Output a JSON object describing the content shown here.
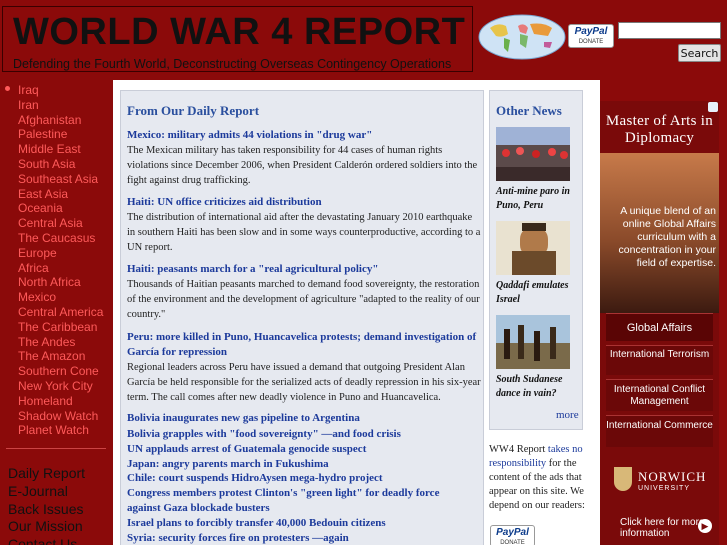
{
  "header": {
    "title": "WORLD WAR 4 REPORT",
    "tagline": "Defending the Fourth World, Deconstructing Overseas Contingency Operations",
    "paypal_label": "PayPal",
    "paypal_sub": "DONATE",
    "search_value": "",
    "search_button": "Search"
  },
  "sidebar": {
    "regions": [
      "Iraq",
      "Iran",
      "Afghanistan",
      "Palestine",
      "Middle East",
      "South Asia",
      "Southeast Asia",
      "East Asia",
      "Oceania",
      "Central Asia",
      "The Caucasus",
      "Europe",
      "Africa",
      "North Africa",
      "Mexico",
      "Central America",
      "The Caribbean",
      "The Andes",
      "The Amazon",
      "Southern Cone",
      "New York City",
      "Homeland",
      "Shadow Watch",
      "Planet Watch"
    ],
    "links": [
      "Daily Report",
      "E-Journal",
      "Back Issues",
      "Our Mission",
      "Contact Us"
    ]
  },
  "daily": {
    "heading": "From Our Daily Report",
    "stories": [
      {
        "title": "Mexico: military admits 44 violations in \"drug war\"",
        "body": "The Mexican military has taken responsibility for 44 cases of human rights violations since December 2006, when President Calderón ordered soldiers into the fight against drug trafficking."
      },
      {
        "title": "Haiti: UN office criticizes aid distribution",
        "body": "The distribution of international aid after the devastating January 2010 earthquake in southern Haiti has been slow and in some ways counterproductive, according to a UN report."
      },
      {
        "title": "Haiti: peasants march for a \"real agricultural policy\"",
        "body": "Thousands of Haitian peasants marched to demand food sovereignty, the restoration of the environment and the development of agriculture \"adapted to the reality of our country.\""
      },
      {
        "title": "Peru: more killed in Puno, Huancavelica protests; demand investigation of García for repression",
        "body": "Regional leaders across Peru have issued a demand that outgoing President Alan García be held responsible for the serialized acts of deadly repression in his six-year term. The call comes after new deadly violence in Puno and Huancavelica."
      }
    ],
    "headlines": [
      "Bolivia inaugurates new gas pipeline to Argentina",
      "Bolivia grapples with \"food sovereignty\" —and food crisis",
      "UN applauds arrest of Guatemala genocide suspect",
      "Japan: angry parents march in Fukushima",
      "Chile: court suspends HidroAysen mega-hydro project",
      "Congress members protest Clinton's \"green light\" for deadly force against Gaza blockade busters",
      "Israel plans to forcibly transfer 40,000 Bedouin citizens",
      "Syria: security forces fire on protesters —again"
    ]
  },
  "other": {
    "heading": "Other News",
    "items": [
      {
        "caption": "Anti-mine paro in Puno, Peru"
      },
      {
        "caption": "Qaddafi emulates Israel"
      },
      {
        "caption": "South Sudanese dance in vain?"
      }
    ],
    "more": "more"
  },
  "disclaimer": {
    "pre": "WW4 Report ",
    "link": "takes no responsibility",
    "post": " for the content of the ads that appear on this site. We depend on our readers:"
  },
  "ad": {
    "title": "Master of Arts in Diplomacy",
    "copy": "A unique blend of an online Global Affairs curriculum with a concentration in your field of expertise.",
    "primary": "Global Affairs",
    "buttons": [
      "International Terrorism",
      "International Conflict Management",
      "International Commerce"
    ],
    "brand": "NORWICH",
    "brand_sub": "UNIVERSITY",
    "cta": "Click here for more information"
  },
  "colors": {
    "brand_red": "#8b0a0a",
    "nav_link": "#ff5a5a",
    "headline_blue": "#1c3a9b",
    "panel_bg": "#e6e9f0"
  }
}
